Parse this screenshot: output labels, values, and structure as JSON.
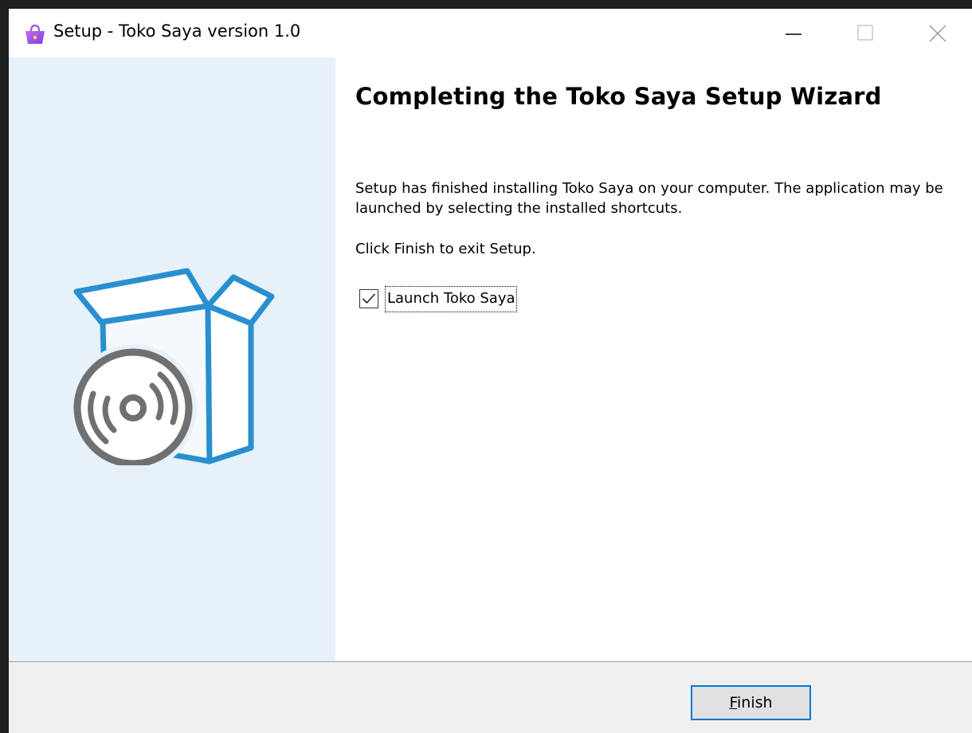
{
  "window": {
    "title": "Setup - Toko Saya version 1.0",
    "app_icon": "shopping-bag-icon"
  },
  "title_controls": {
    "minimize_icon": "minimize-icon",
    "maximize_icon": "maximize-icon",
    "close_icon": "close-icon"
  },
  "side_panel": {
    "image": "software-box-cd-icon",
    "background": "#e6f1f9",
    "box_color": "#2a8fcf",
    "disc_color": "#707070"
  },
  "main": {
    "heading": "Completing the Toko Saya Setup Wizard",
    "paragraph_1": "Setup has finished installing Toko Saya on your computer. The application may be launched by selecting the installed shortcuts.",
    "paragraph_2": "Click Finish to exit Setup.",
    "launch_checkbox": {
      "label": "Launch Toko Saya",
      "checked": true
    }
  },
  "footer": {
    "finish_mnemonic": "F",
    "finish_rest": "inish",
    "accent": "#0078d7"
  }
}
